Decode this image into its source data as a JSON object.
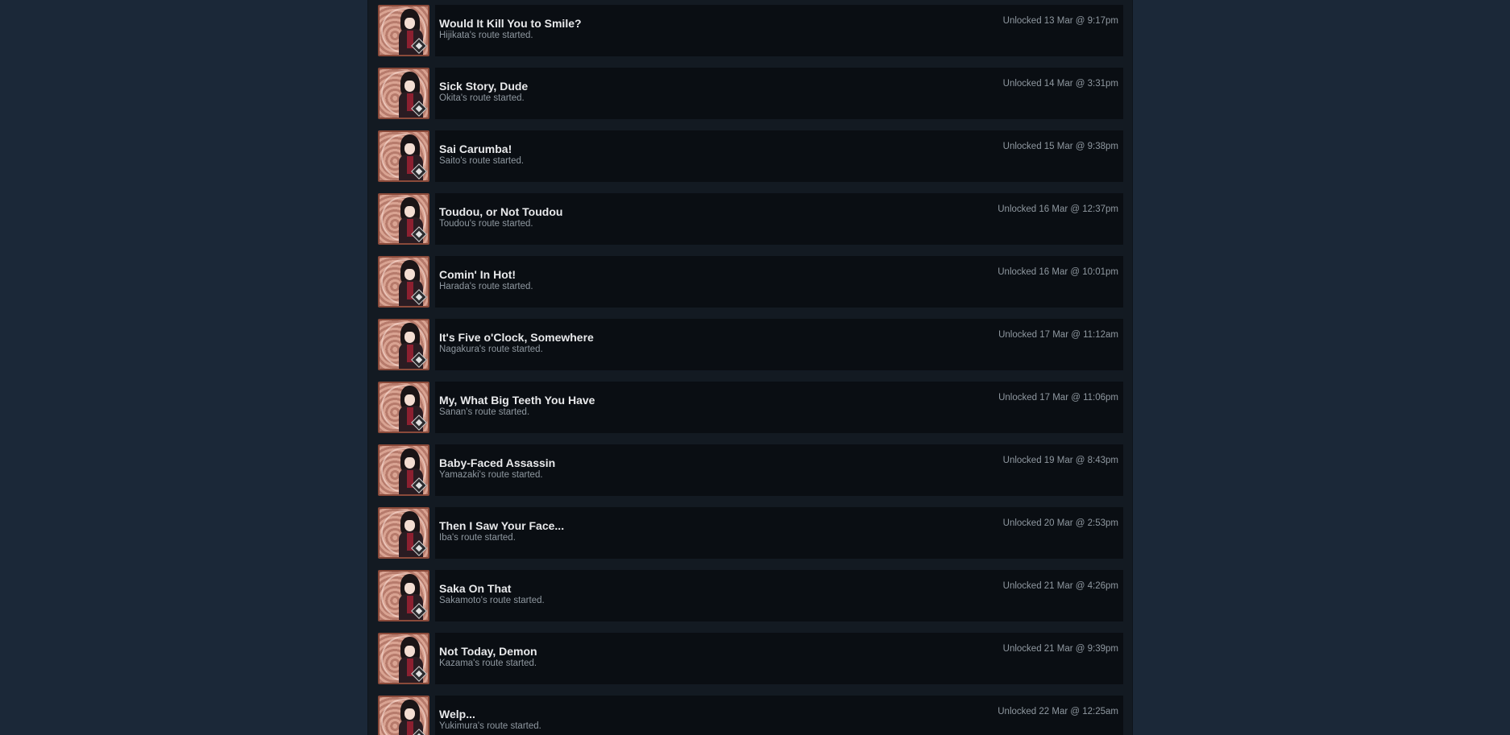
{
  "achievements": [
    {
      "title": "Would It Kill You to Smile?",
      "description": "Hijikata's route started.",
      "unlock_time": "Unlocked 13 Mar @ 9:17pm",
      "icon": "achievement-badge-icon"
    },
    {
      "title": "Sick Story, Dude",
      "description": "Okita's route started.",
      "unlock_time": "Unlocked 14 Mar @ 3:31pm",
      "icon": "achievement-badge-icon"
    },
    {
      "title": "Sai Carumba!",
      "description": "Saito's route started.",
      "unlock_time": "Unlocked 15 Mar @ 9:38pm",
      "icon": "achievement-badge-icon"
    },
    {
      "title": "Toudou, or Not Toudou",
      "description": "Toudou's route started.",
      "unlock_time": "Unlocked 16 Mar @ 12:37pm",
      "icon": "achievement-badge-icon"
    },
    {
      "title": "Comin' In Hot!",
      "description": "Harada's route started.",
      "unlock_time": "Unlocked 16 Mar @ 10:01pm",
      "icon": "achievement-badge-icon"
    },
    {
      "title": "It's Five o'Clock, Somewhere",
      "description": "Nagakura's route started.",
      "unlock_time": "Unlocked 17 Mar @ 11:12am",
      "icon": "achievement-badge-icon"
    },
    {
      "title": "My, What Big Teeth You Have",
      "description": "Sanan's route started.",
      "unlock_time": "Unlocked 17 Mar @ 11:06pm",
      "icon": "achievement-badge-icon"
    },
    {
      "title": "Baby-Faced Assassin",
      "description": "Yamazaki's route started.",
      "unlock_time": "Unlocked 19 Mar @ 8:43pm",
      "icon": "achievement-badge-icon"
    },
    {
      "title": "Then I Saw Your Face...",
      "description": "Iba's route started.",
      "unlock_time": "Unlocked 20 Mar @ 2:53pm",
      "icon": "achievement-badge-icon"
    },
    {
      "title": "Saka On That",
      "description": "Sakamoto's route started.",
      "unlock_time": "Unlocked 21 Mar @ 4:26pm",
      "icon": "achievement-badge-icon"
    },
    {
      "title": "Not Today, Demon",
      "description": "Kazama's route started.",
      "unlock_time": "Unlocked 21 Mar @ 9:39pm",
      "icon": "achievement-badge-icon"
    },
    {
      "title": "Welp...",
      "description": "Yukimura's route started.",
      "unlock_time": "Unlocked 22 Mar @ 12:25am",
      "icon": "achievement-badge-icon"
    }
  ],
  "colors": {
    "background": "#1b2838",
    "panel": "#131a22",
    "card": "#0a0e13",
    "title_text": "#e8e9eb",
    "secondary_text": "#8f98a0"
  }
}
